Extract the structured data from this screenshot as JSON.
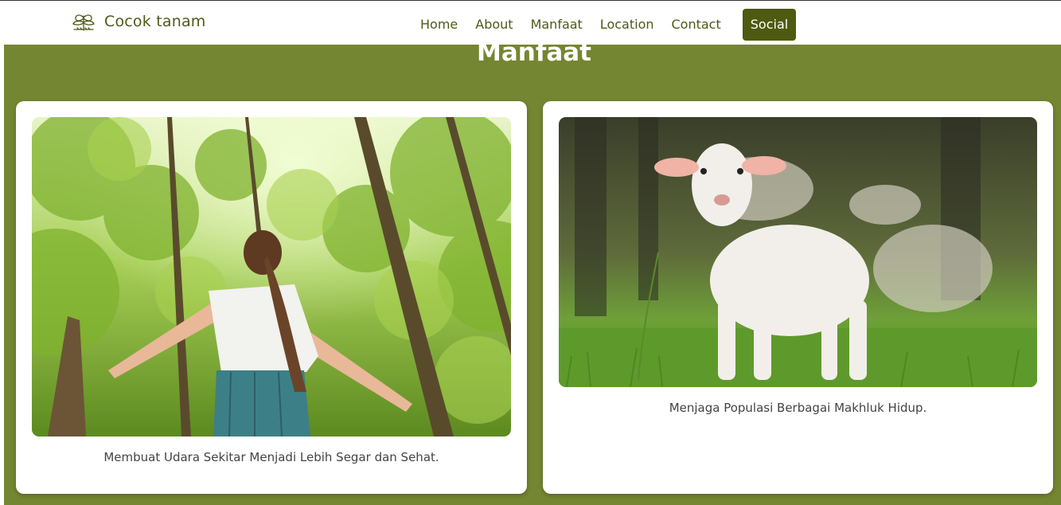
{
  "navbar": {
    "brand": "Cocok tanam",
    "brand_icon": "sprout-icon",
    "links": [
      "Home",
      "About",
      "Manfaat",
      "Location",
      "Contact"
    ],
    "social": "Social"
  },
  "section": {
    "title": "Manfaat"
  },
  "cards": [
    {
      "image": "woman-in-forest-photo",
      "caption": "Membuat Udara Sekitar Menjadi Lebih Segar dan Sehat."
    },
    {
      "image": "lamb-in-meadow-photo",
      "caption": "Menjaga Populasi Berbagai Makhluk Hidup."
    }
  ],
  "colors": {
    "brand_text": "#4e5a17",
    "social_button": "#4e5a10",
    "section_background": "#758632"
  }
}
